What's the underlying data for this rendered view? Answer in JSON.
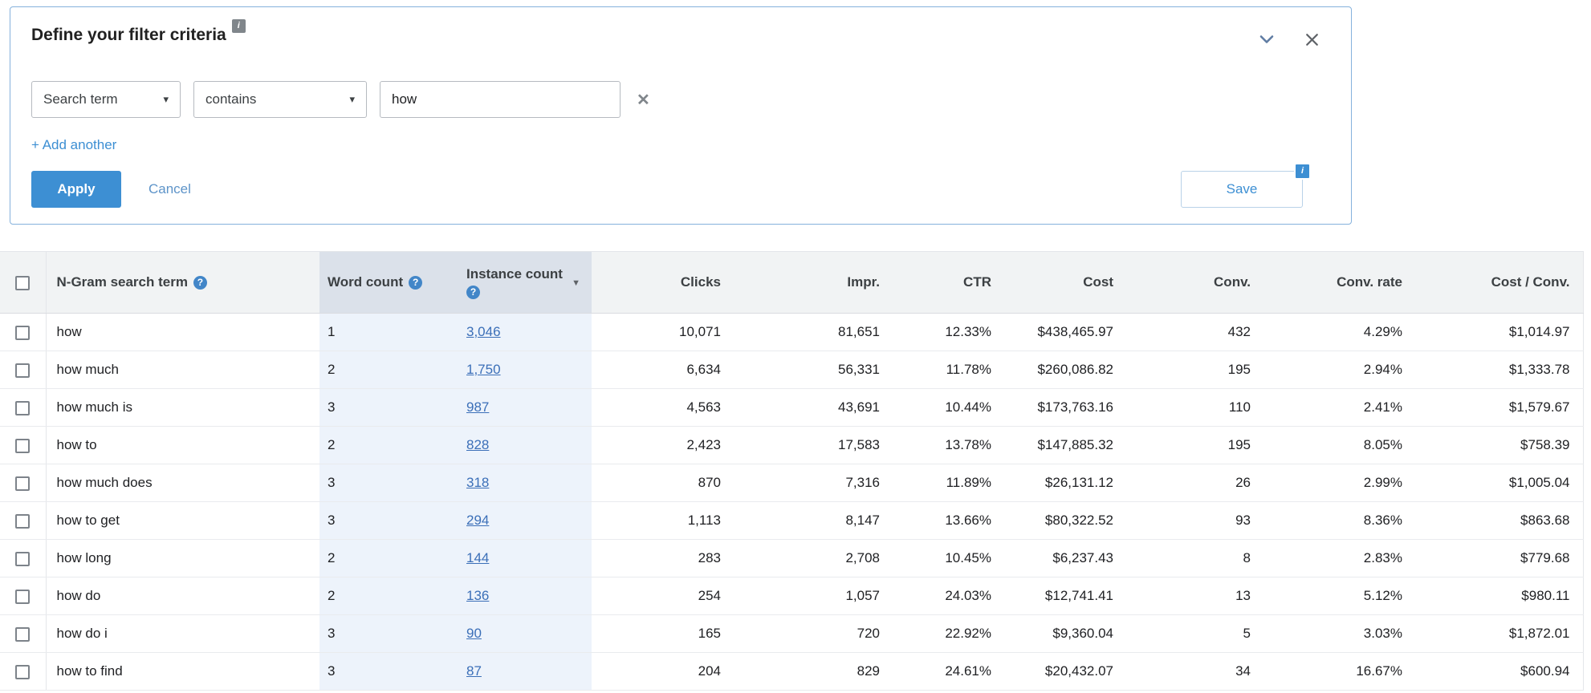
{
  "filter_panel": {
    "title": "Define your filter criteria",
    "field_dropdown": {
      "value": "Search term"
    },
    "operator_dropdown": {
      "value": "contains"
    },
    "value_input": {
      "value": "how"
    },
    "add_another_label": "+ Add another",
    "apply_label": "Apply",
    "cancel_label": "Cancel",
    "save_label": "Save"
  },
  "icons": {
    "info": "i",
    "help": "?",
    "caret_down": "▾",
    "sort_desc": "▼",
    "clear": "✕"
  },
  "table": {
    "headers": {
      "term": "N-Gram search term",
      "word_count": "Word count",
      "instance_count": "Instance count",
      "clicks": "Clicks",
      "impr": "Impr.",
      "ctr": "CTR",
      "cost": "Cost",
      "conv": "Conv.",
      "conv_rate": "Conv. rate",
      "cost_conv": "Cost / Conv."
    },
    "rows": [
      [
        "how",
        "1",
        "3,046",
        "10,071",
        "81,651",
        "12.33%",
        "$438,465.97",
        "432",
        "4.29%",
        "$1,014.97"
      ],
      [
        "how much",
        "2",
        "1,750",
        "6,634",
        "56,331",
        "11.78%",
        "$260,086.82",
        "195",
        "2.94%",
        "$1,333.78"
      ],
      [
        "how much is",
        "3",
        "987",
        "4,563",
        "43,691",
        "10.44%",
        "$173,763.16",
        "110",
        "2.41%",
        "$1,579.67"
      ],
      [
        "how to",
        "2",
        "828",
        "2,423",
        "17,583",
        "13.78%",
        "$147,885.32",
        "195",
        "8.05%",
        "$758.39"
      ],
      [
        "how much does",
        "3",
        "318",
        "870",
        "7,316",
        "11.89%",
        "$26,131.12",
        "26",
        "2.99%",
        "$1,005.04"
      ],
      [
        "how to get",
        "3",
        "294",
        "1,113",
        "8,147",
        "13.66%",
        "$80,322.52",
        "93",
        "8.36%",
        "$863.68"
      ],
      [
        "how long",
        "2",
        "144",
        "283",
        "2,708",
        "10.45%",
        "$6,237.43",
        "8",
        "2.83%",
        "$779.68"
      ],
      [
        "how do",
        "2",
        "136",
        "254",
        "1,057",
        "24.03%",
        "$12,741.41",
        "13",
        "5.12%",
        "$980.11"
      ],
      [
        "how do i",
        "3",
        "90",
        "165",
        "720",
        "22.92%",
        "$9,360.04",
        "5",
        "3.03%",
        "$1,872.01"
      ],
      [
        "how to find",
        "3",
        "87",
        "204",
        "829",
        "24.61%",
        "$20,432.07",
        "34",
        "16.67%",
        "$600.94"
      ]
    ]
  },
  "colors": {
    "accent_blue": "#3d8fd3",
    "link_blue": "#3b6fb8",
    "header_bg": "#f1f3f4",
    "highlight_header_bg": "#dbe1ea",
    "highlight_col_bg": "#edf3fb",
    "panel_border": "#85b1dc"
  }
}
